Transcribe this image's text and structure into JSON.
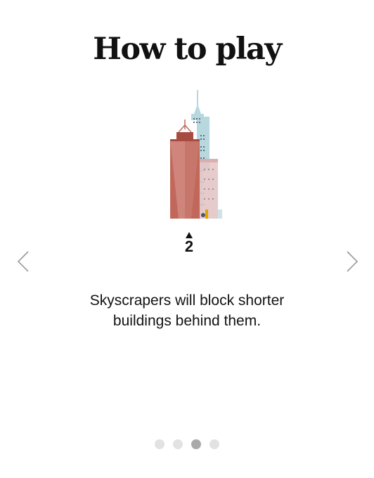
{
  "title": "How to play",
  "slide": {
    "clue_number": "2",
    "description_line1": "Skyscrapers will block shorter",
    "description_line2": "buildings behind them.",
    "illustration_icon": "skyscrapers-illustration"
  },
  "navigation": {
    "prev_icon": "chevron-left-icon",
    "next_icon": "chevron-right-icon"
  },
  "pagination": {
    "total": 4,
    "current": 3
  },
  "colors": {
    "front_building": "#c2685b",
    "back_building": "#b7d8de",
    "middle_building": "#e6c6c6",
    "active_dot": "#a9a9a9",
    "inactive_dot": "#e2e2e2"
  }
}
